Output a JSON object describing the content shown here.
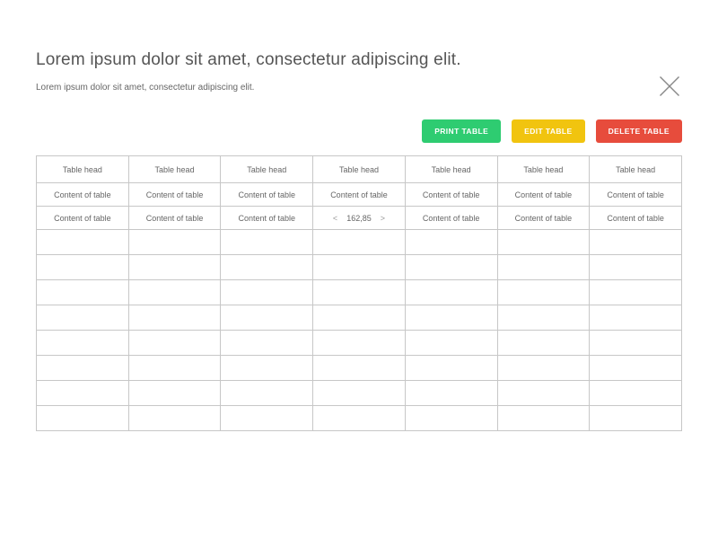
{
  "header": {
    "title": "Lorem ipsum dolor sit amet, consectetur adipiscing elit.",
    "subtitle": "Lorem ipsum dolor sit amet, consectetur adipiscing elit."
  },
  "toolbar": {
    "print_label": "PRINT TABLE",
    "edit_label": "EDIT TABLE",
    "delete_label": "DELETE TABLE"
  },
  "table": {
    "headers": [
      "Table head",
      "Table head",
      "Table head",
      "Table head",
      "Table head",
      "Table head",
      "Table head"
    ],
    "rows": [
      [
        "Content of table",
        "Content of table",
        "Content of table",
        "Content of table",
        "Content of table",
        "Content of table",
        "Content of table"
      ],
      [
        "Content of table",
        "Content of table",
        "Content of table",
        {
          "stepper": true,
          "value": "162,85"
        },
        "Content of table",
        "Content of table",
        "Content of table"
      ]
    ],
    "empty_row_count": 8
  }
}
